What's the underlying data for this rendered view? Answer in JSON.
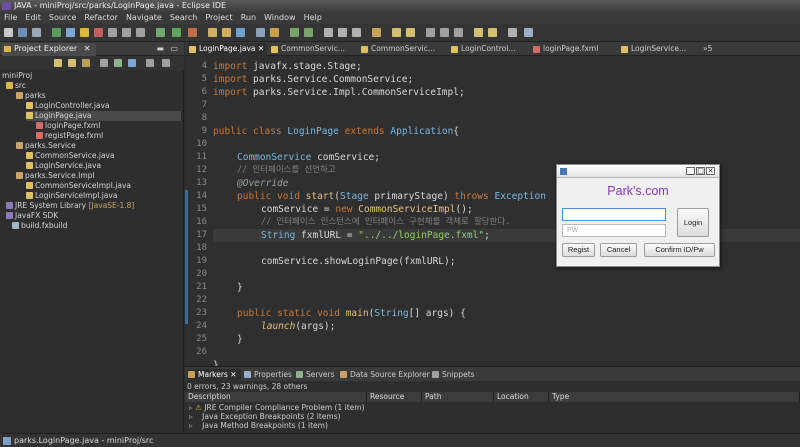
{
  "window": {
    "title": "JAVA - miniProj/src/parks/LoginPage.java - Eclipse IDE"
  },
  "menu": [
    "File",
    "Edit",
    "Source",
    "Refactor",
    "Navigate",
    "Search",
    "Project",
    "Run",
    "Window",
    "Help"
  ],
  "explorer": {
    "title": "Project Explorer",
    "root": "miniProj",
    "items": [
      {
        "label": "src",
        "icon": "package-folder-icon"
      },
      {
        "label": "parks",
        "icon": "package-icon"
      },
      {
        "label": "LoginController.java",
        "icon": "java-file-icon"
      },
      {
        "label": "LoginPage.java",
        "icon": "java-file-icon"
      },
      {
        "label": "loginPage.fxml",
        "icon": "fxml-file-icon"
      },
      {
        "label": "registPage.fxml",
        "icon": "fxml-file-icon"
      },
      {
        "label": "parks.Service",
        "icon": "package-icon"
      },
      {
        "label": "CommonService.java",
        "icon": "java-file-icon"
      },
      {
        "label": "LoginService.java",
        "icon": "java-file-icon"
      },
      {
        "label": "parks.Service.Impl",
        "icon": "package-icon"
      },
      {
        "label": "CommonServiceImpl.java",
        "icon": "java-file-icon"
      },
      {
        "label": "LoginServiceImpl.java",
        "icon": "java-file-icon"
      },
      {
        "label": "JRE System Library",
        "extra": "[JavaSE-1.8]",
        "icon": "library-icon"
      },
      {
        "label": "JavaFX SDK",
        "icon": "library-icon"
      },
      {
        "label": "build.fxbuild",
        "icon": "build-file-icon"
      }
    ]
  },
  "editor": {
    "tabs": [
      {
        "label": "LoginPage.java",
        "active": true,
        "close": "✕"
      },
      {
        "label": "CommonServic..."
      },
      {
        "label": "CommonServic..."
      },
      {
        "label": "LoginControl..."
      },
      {
        "label": "loginPage.fxml"
      },
      {
        "label": "LoginService..."
      },
      {
        "label": "»5"
      }
    ],
    "line_numbers": [
      "4",
      "5",
      "6",
      "7",
      "8",
      "9",
      "10",
      "11",
      "12",
      "13",
      "14",
      "15",
      "16",
      "17",
      "18",
      "19",
      "20",
      "21",
      "22",
      "23",
      "24",
      "25",
      "26"
    ],
    "code": {
      "l4a": "import",
      "l4b": " javafx.stage.Stage;",
      "l5a": "import",
      "l5b": " parks.Service.CommonService;",
      "l6a": "import",
      "l6b": " parks.Service.Impl.CommonServiceImpl;",
      "l8a": "public class",
      "l8b": "LoginPage",
      "l8c": "extends",
      "l8d": "Application",
      "l8e": "{",
      "l10a": "CommonService",
      "l10b": " comService;",
      "l11": "// 인터페이스를 선언하고",
      "l12": "@Override",
      "l13a": "public void",
      "l13b": "start",
      "l13c": "(",
      "l13d": "Stage",
      "l13e": " primaryStage) ",
      "l13f": "throws",
      "l13g": "Exception",
      "l14a": "comService = ",
      "l14b": "new",
      "l14c": "CommonServiceImpl",
      "l14d": "();",
      "l15": "// 인터페이스 인스턴스에 인터페이스 구현체를 객체로 할당한다.",
      "l16a": "String",
      "l16b": " fxmlURL = ",
      "l16c": "\"../../loginPage.fxml\"",
      "l16d": ";",
      "l18": "comService.showLoginPage(fxmlURL);",
      "l20": "}",
      "l22a": "public static void",
      "l22b": "main",
      "l22c": "(",
      "l22d": "String",
      "l22e": "[] args) {",
      "l23a": "launch",
      "l23b": "(args);",
      "l24": "}",
      "l26": "}"
    }
  },
  "bottom": {
    "tabs": [
      "Markers",
      "Properties",
      "Servers",
      "Data Source Explorer",
      "Snippets"
    ],
    "summary": "0 errors, 23 warnings, 28 others",
    "columns": [
      "Description",
      "Resource",
      "Path",
      "Location",
      "Type"
    ],
    "rows": [
      "JRE Compiler Compliance Problem (1 item)",
      "Java Exception Breakpoints (2 items)",
      "Java Method Breakpoints (1 item)"
    ]
  },
  "status": {
    "text": "parks.LoginPage.java - miniProj/src"
  },
  "dialog": {
    "heading": "Park's.com",
    "id_value": "",
    "pw_placeholder": "PW",
    "login_label": "Login",
    "regist_label": "Regist",
    "cancel_label": "Cancel",
    "confirm_label": "Confirm ID/Pw",
    "minimize": "_",
    "maximize": "□",
    "close": "✕"
  },
  "colors": {
    "keyword": "#cc7832",
    "type": "#7ab8e0",
    "string": "#8fcf6e",
    "comment": "#808080",
    "dialog_heading": "#8a34b8"
  }
}
